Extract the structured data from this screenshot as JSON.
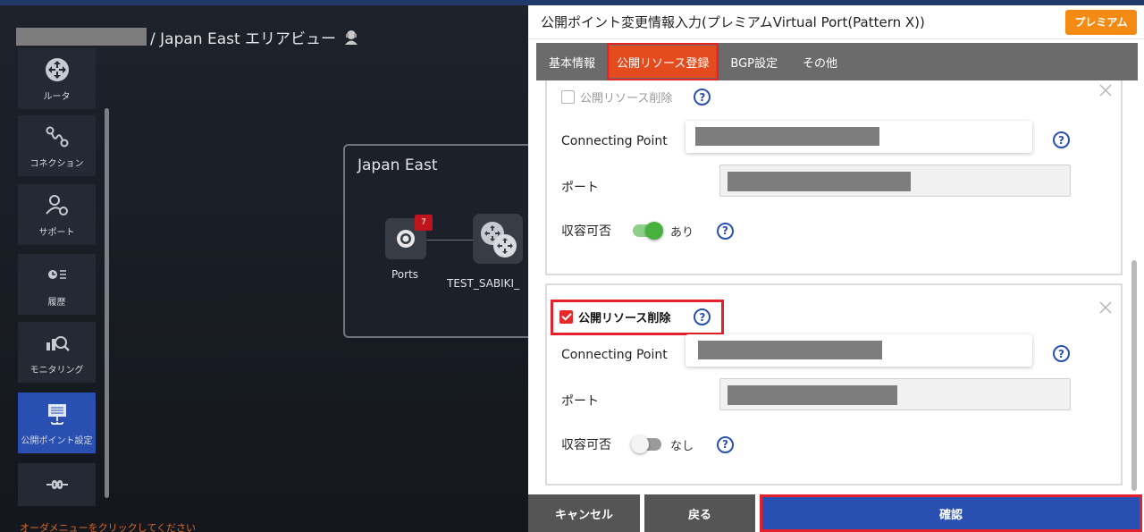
{
  "breadcrumb": {
    "text": "/ Japan East エリアビュー"
  },
  "sidebar": {
    "items": [
      {
        "label": "ルータ",
        "icon": "router-icon"
      },
      {
        "label": "コネクション",
        "icon": "connection-icon"
      },
      {
        "label": "サポート",
        "icon": "support-icon"
      },
      {
        "label": "履歴",
        "icon": "history-icon"
      },
      {
        "label": "モニタリング",
        "icon": "monitoring-icon"
      },
      {
        "label": "公開ポイント設定",
        "icon": "public-point-icon",
        "active": true
      },
      {
        "label": "",
        "icon": "cloud-connect-icon"
      }
    ],
    "order_message": "オーダメニューをクリックしてください"
  },
  "canvas": {
    "region_title": "Japan East",
    "ports_label": "Ports",
    "ports_badge": "7",
    "router_label": "TEST_SABIKI_"
  },
  "panel": {
    "title": "公開ポイント変更情報入力(プレミアムVirtual Port(Pattern X))",
    "premium_label": "プレミアム",
    "tabs": [
      "基本情報",
      "公開リソース登録",
      "BGP設定",
      "その他"
    ],
    "active_tab": 1,
    "cards": [
      {
        "delete_label": "公開リソース削除",
        "delete_checked": false,
        "connecting_point_label": "Connecting Point",
        "port_label": "ポート",
        "capacity_label": "収容可否",
        "capacity_value": "あり",
        "capacity_on": true
      },
      {
        "delete_label": "公開リソース削除",
        "delete_checked": true,
        "connecting_point_label": "Connecting Point",
        "port_label": "ポート",
        "capacity_label": "収容可否",
        "capacity_value": "なし",
        "capacity_on": false
      }
    ],
    "help_glyph": "?",
    "footer": {
      "cancel": "キャンセル",
      "back": "戻る",
      "confirm": "確認"
    }
  },
  "colors": {
    "accent_blue": "#2a4fb3",
    "premium_orange": "#f28a14",
    "highlight_red": "#e3202b",
    "toggle_green": "#46b23c"
  }
}
